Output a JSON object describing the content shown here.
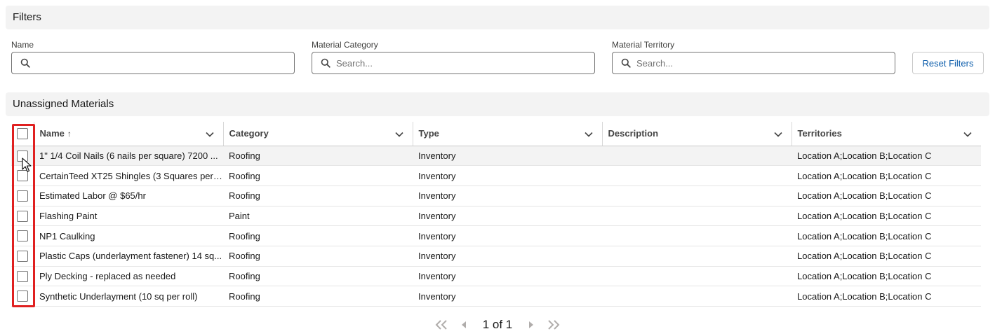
{
  "filters": {
    "title": "Filters",
    "name": {
      "label": "Name",
      "value": "",
      "placeholder": ""
    },
    "category": {
      "label": "Material Category",
      "value": "",
      "placeholder": "Search..."
    },
    "territory": {
      "label": "Material Territory",
      "value": "",
      "placeholder": "Search..."
    },
    "reset_label": "Reset Filters"
  },
  "materials": {
    "title": "Unassigned Materials",
    "columns": [
      "Name",
      "Category",
      "Type",
      "Description",
      "Territories"
    ],
    "sort_indicator": "↑",
    "rows": [
      {
        "name": "1\" 1/4 Coil Nails (6 nails per square) 7200 ...",
        "category": "Roofing",
        "type": "Inventory",
        "description": "",
        "territories": "Location A;Location B;Location C"
      },
      {
        "name": "CertainTeed XT25 Shingles (3 Squares per ...",
        "category": "Roofing",
        "type": "Inventory",
        "description": "",
        "territories": "Location A;Location B;Location C"
      },
      {
        "name": "Estimated Labor @ $65/hr",
        "category": "Roofing",
        "type": "Inventory",
        "description": "",
        "territories": "Location A;Location B;Location C"
      },
      {
        "name": "Flashing Paint",
        "category": "Paint",
        "type": "Inventory",
        "description": "",
        "territories": "Location A;Location B;Location C"
      },
      {
        "name": "NP1 Caulking",
        "category": "Roofing",
        "type": "Inventory",
        "description": "",
        "territories": "Location A;Location B;Location C"
      },
      {
        "name": "Plastic Caps (underlayment fastener) 14 sq...",
        "category": "Roofing",
        "type": "Inventory",
        "description": "",
        "territories": "Location A;Location B;Location C"
      },
      {
        "name": "Ply Decking - replaced as needed",
        "category": "Roofing",
        "type": "Inventory",
        "description": "",
        "territories": "Location A;Location B;Location C"
      },
      {
        "name": "Synthetic Underlayment (10 sq per roll)",
        "category": "Roofing",
        "type": "Inventory",
        "description": "",
        "territories": "Location A;Location B;Location C"
      }
    ]
  },
  "pagination": {
    "text": "1 of 1"
  },
  "colors": {
    "highlight": "#e02020",
    "link": "#0b5cab",
    "header_bg": "#f3f3f3"
  }
}
